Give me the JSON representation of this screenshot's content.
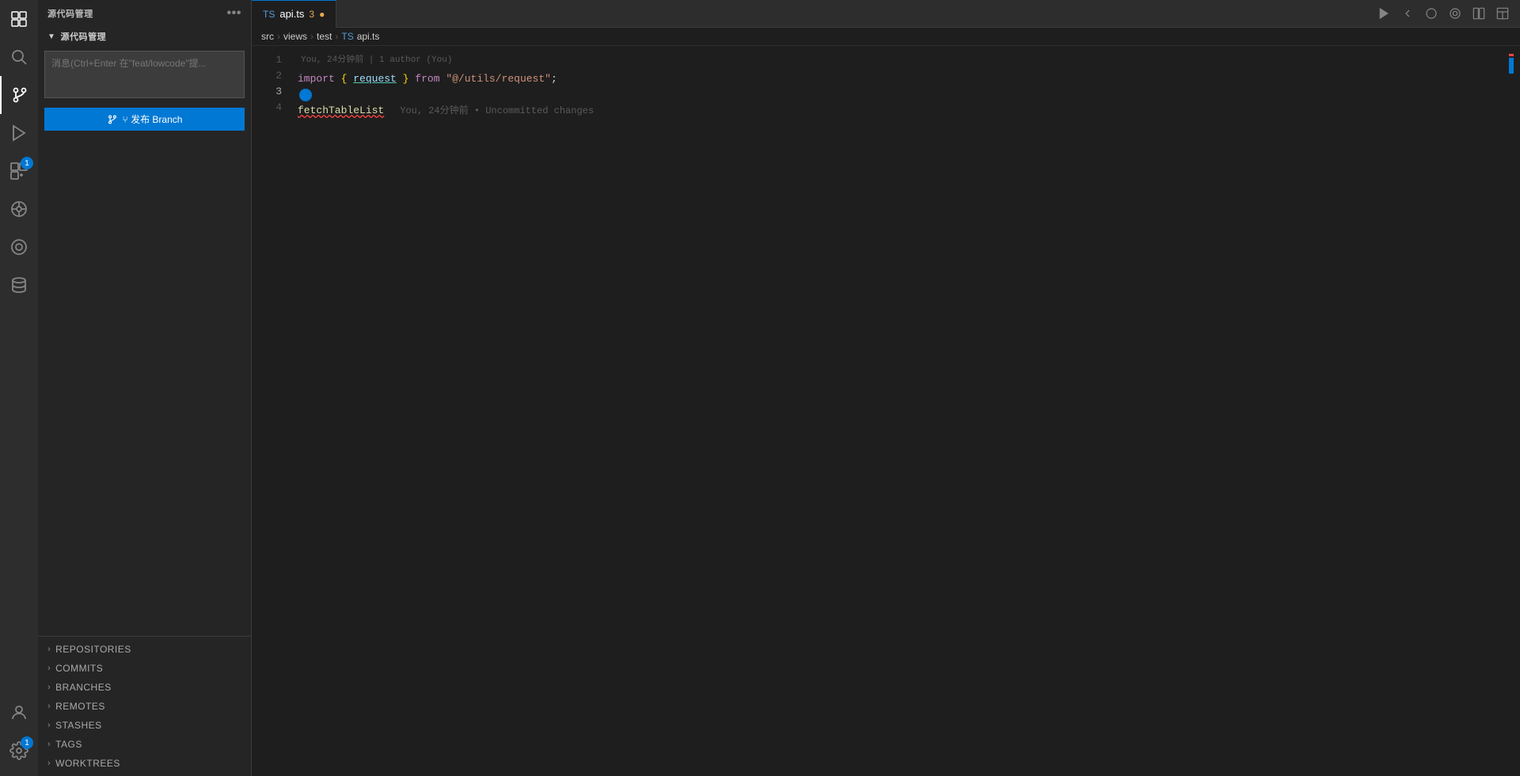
{
  "activityBar": {
    "icons": [
      {
        "name": "explorer-icon",
        "symbol": "⬜",
        "active": false,
        "badge": null
      },
      {
        "name": "search-icon",
        "symbol": "🔍",
        "active": false,
        "badge": null
      },
      {
        "name": "source-control-icon",
        "symbol": "⑂",
        "active": true,
        "badge": null
      },
      {
        "name": "run-debug-icon",
        "symbol": "▷",
        "active": false,
        "badge": null
      },
      {
        "name": "extensions-icon",
        "symbol": "⧉",
        "active": false,
        "badge": "1"
      },
      {
        "name": "remote-icon",
        "symbol": "◎",
        "active": false,
        "badge": null
      },
      {
        "name": "gitlens-icon",
        "symbol": "◉",
        "active": false,
        "badge": null
      },
      {
        "name": "database-icon",
        "symbol": "🗄",
        "active": false,
        "badge": null
      }
    ],
    "bottomIcons": [
      {
        "name": "account-icon",
        "symbol": "👤",
        "active": false,
        "badge": null
      },
      {
        "name": "settings-icon",
        "symbol": "⚙",
        "active": false,
        "badge": "1"
      }
    ]
  },
  "sidebar": {
    "title": "源代码管理",
    "moreLabel": "•••",
    "sectionTitle": "源代码管理",
    "messageInputPlaceholder": "消息(Ctrl+Enter 在\"feat/lowcode\"提...",
    "publishBtnLabel": "⑂ 发布 Branch",
    "bottomSections": [
      {
        "id": "repositories",
        "label": "REPOSITORIES"
      },
      {
        "id": "commits",
        "label": "COMMITS"
      },
      {
        "id": "branches",
        "label": "BRANCHES"
      },
      {
        "id": "remotes",
        "label": "REMOTES"
      },
      {
        "id": "stashes",
        "label": "STASHES"
      },
      {
        "id": "tags",
        "label": "TAGS"
      },
      {
        "id": "worktrees",
        "label": "WORKTREES"
      }
    ]
  },
  "tabBar": {
    "tabs": [
      {
        "id": "api-ts",
        "langLabel": "TS",
        "filename": "api.ts",
        "dirty": true,
        "active": true
      }
    ],
    "dirtyCount": "3"
  },
  "breadcrumb": {
    "parts": [
      "src",
      "views",
      "test",
      "api.ts"
    ]
  },
  "editor": {
    "lines": [
      {
        "number": 1,
        "content": "import { request } from \"@/utils/request\";",
        "annotation": ""
      },
      {
        "number": 2,
        "content": "",
        "annotation": "",
        "hasAvatar": true
      },
      {
        "number": 3,
        "content": "fetchTableList",
        "annotation": "You, 24分钟前 • Uncommitted changes"
      },
      {
        "number": 4,
        "content": "",
        "annotation": ""
      }
    ],
    "blameInfo": "You, 24分钟前 | 1 author (You)"
  }
}
